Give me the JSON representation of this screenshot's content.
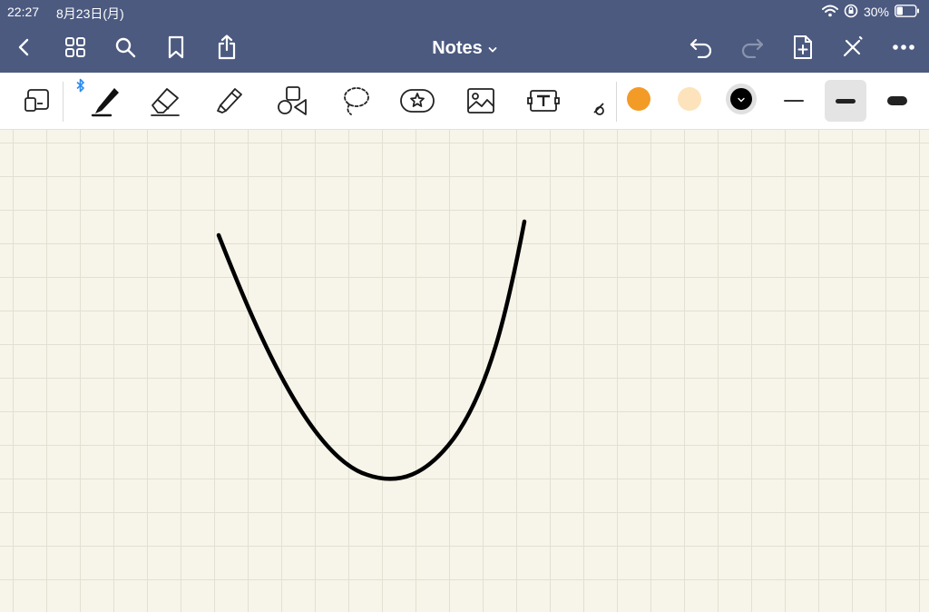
{
  "status": {
    "time": "22:27",
    "date": "8月23日(月)",
    "battery": "30%"
  },
  "document": {
    "title": "Notes"
  },
  "icons": {
    "back": "chevron-left-icon",
    "grid": "grid-icon",
    "search": "search-icon",
    "bookmark": "bookmark-icon",
    "share": "share-icon",
    "undo": "undo-icon",
    "redo": "redo-icon",
    "add_page": "add-page-icon",
    "pencil_off": "pencil-off-icon",
    "more": "more-icon"
  },
  "tools": [
    "zoom-window",
    "pen",
    "eraser",
    "highlighter",
    "shapes",
    "lasso",
    "sticker",
    "image",
    "text",
    "laser-pointer"
  ],
  "colors": {
    "topbar": "#4c5a80",
    "swatch_orange": "#f39b27",
    "swatch_peach": "#fde3bb",
    "swatch_black": "#000000",
    "paper": "#f7f5e9",
    "grid": "#e2e0d2",
    "bluetooth": "#2a8cf0"
  },
  "stroke_widths": [
    "thin",
    "medium",
    "thick"
  ],
  "selected_stroke": "medium"
}
